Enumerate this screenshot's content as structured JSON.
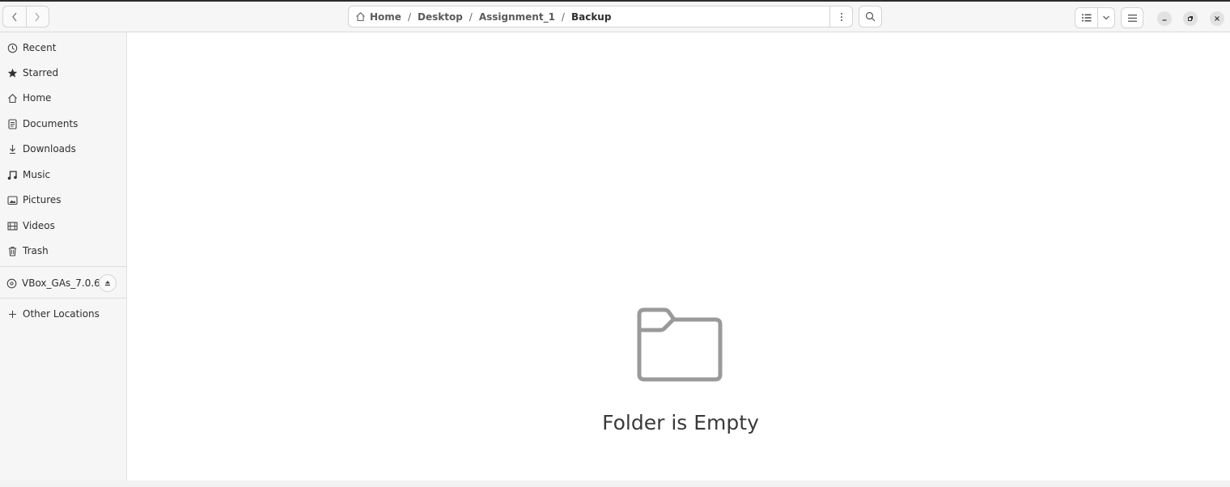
{
  "window": {
    "breadcrumb": [
      "Home",
      "Desktop",
      "Assignment_1",
      "Backup"
    ],
    "separator": "/"
  },
  "sidebar": {
    "items": [
      {
        "label": "Recent",
        "icon": "clock-icon"
      },
      {
        "label": "Starred",
        "icon": "star-icon"
      },
      {
        "label": "Home",
        "icon": "home-icon"
      },
      {
        "label": "Documents",
        "icon": "document-icon"
      },
      {
        "label": "Downloads",
        "icon": "download-icon"
      },
      {
        "label": "Music",
        "icon": "music-icon"
      },
      {
        "label": "Pictures",
        "icon": "picture-icon"
      },
      {
        "label": "Videos",
        "icon": "film-icon"
      },
      {
        "label": "Trash",
        "icon": "trash-icon"
      }
    ],
    "device": {
      "label": "VBox_GAs_7.0.6",
      "icon": "disc-icon"
    },
    "other": {
      "label": "Other Locations",
      "icon": "plus-icon"
    }
  },
  "main": {
    "empty_message": "Folder is Empty",
    "empty_icon": "folder-icon"
  }
}
